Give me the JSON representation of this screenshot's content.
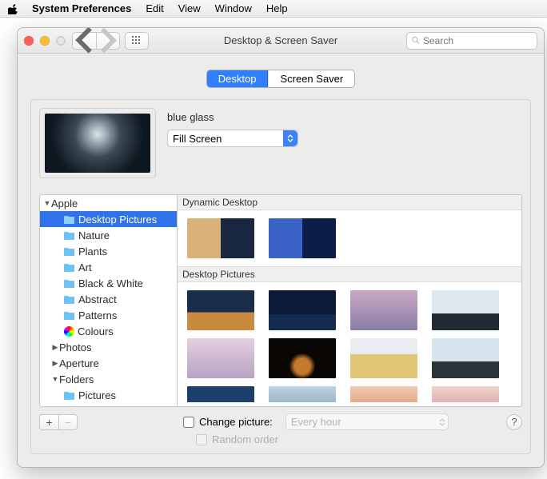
{
  "menubar": {
    "app": "System Preferences",
    "items": [
      "Edit",
      "View",
      "Window",
      "Help"
    ]
  },
  "window": {
    "title": "Desktop & Screen Saver",
    "search_placeholder": "Search",
    "tabs": {
      "desktop": "Desktop",
      "screensaver": "Screen Saver"
    },
    "wallpaper_name": "blue glass",
    "fit_mode": "Fill Screen",
    "sections": {
      "dynamic": "Dynamic Desktop",
      "pictures": "Desktop Pictures"
    },
    "change_label": "Change picture:",
    "random_label": "Random order",
    "interval": "Every hour"
  },
  "sidebar": {
    "apple": "Apple",
    "items": [
      "Desktop Pictures",
      "Nature",
      "Plants",
      "Art",
      "Black & White",
      "Abstract",
      "Patterns",
      "Colours"
    ],
    "photos": "Photos",
    "aperture": "Aperture",
    "folders": "Folders",
    "folder_items": [
      "Pictures"
    ]
  }
}
